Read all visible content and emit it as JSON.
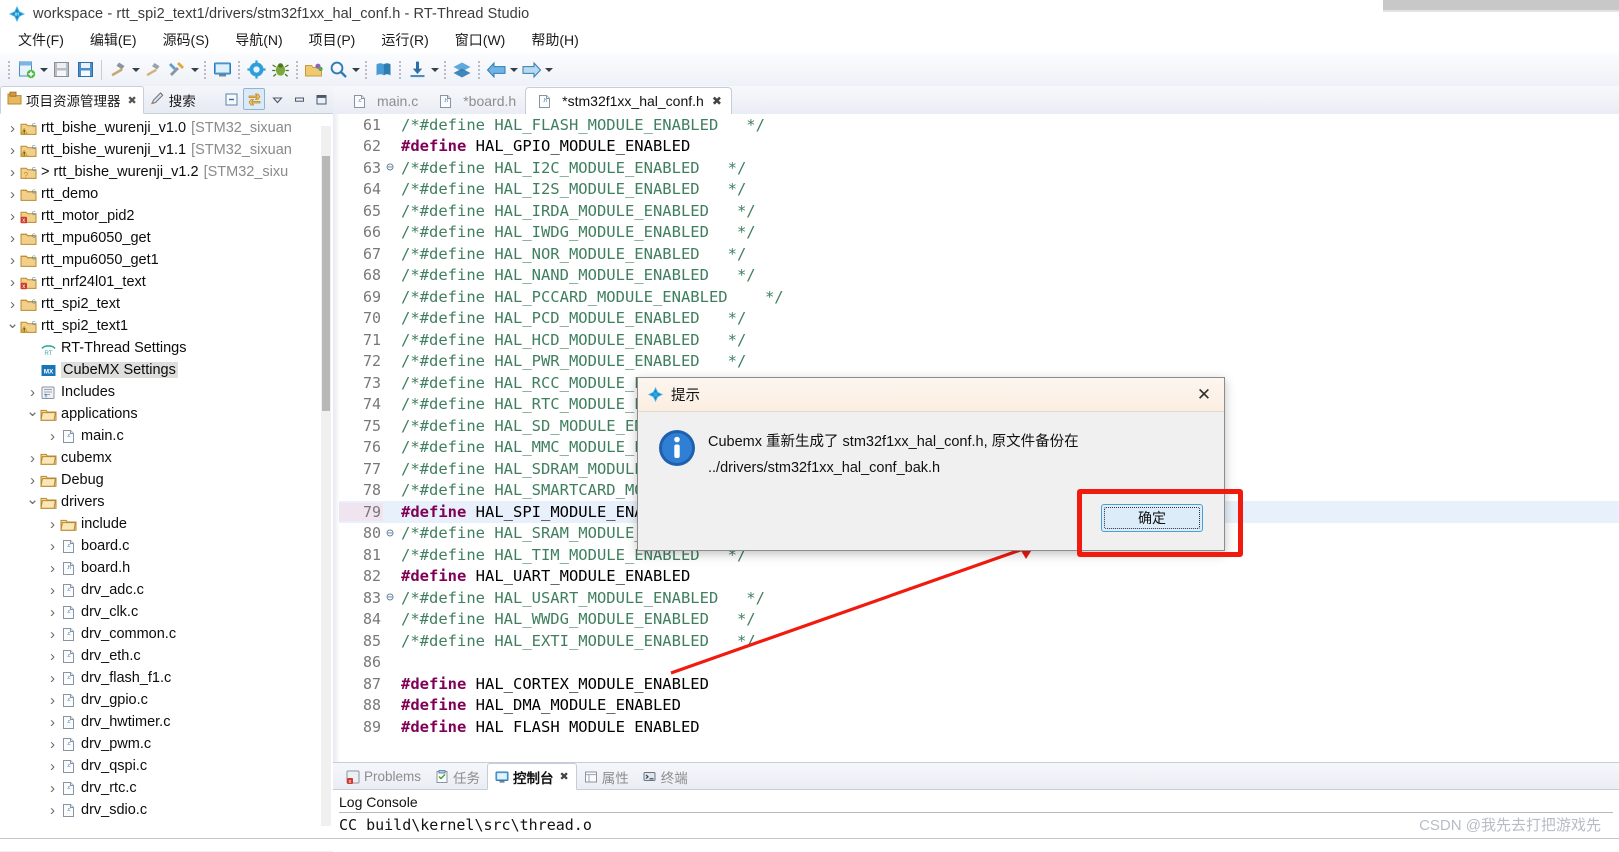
{
  "window": {
    "title": "workspace - rtt_spi2_text1/drivers/stm32f1xx_hal_conf.h - RT-Thread Studio",
    "app_icon": "rt-thread-logo-icon"
  },
  "menu": [
    {
      "label": "文件(F)",
      "mnemonic": "F"
    },
    {
      "label": "编辑(E)",
      "mnemonic": "E"
    },
    {
      "label": "源码(S)",
      "mnemonic": "S"
    },
    {
      "label": "导航(N)",
      "mnemonic": "N"
    },
    {
      "label": "项目(P)",
      "mnemonic": "P"
    },
    {
      "label": "运行(R)",
      "mnemonic": "R"
    },
    {
      "label": "窗口(W)",
      "mnemonic": "W"
    },
    {
      "label": "帮助(H)",
      "mnemonic": "H"
    }
  ],
  "toolbar": {
    "items": [
      "new-project-icon",
      "dropdown-arrow",
      "save-icon",
      "save-all-icon",
      "separator",
      "build-hammer-icon",
      "dropdown-arrow",
      "clean-icon",
      "build-config-icon",
      "dropdown-arrow",
      "separator",
      "open-terminal-icon",
      "separator",
      "settings-gear-icon",
      "debug-bug-icon",
      "separator",
      "open-resource-icon",
      "search-icon",
      "dropdown-arrow",
      "separator",
      "rtthread-pkg-icon",
      "separator",
      "download-flash-icon",
      "dropdown-arrow",
      "separator",
      "layers-icon",
      "separator",
      "back-arrow-icon",
      "dropdown-arrow",
      "forward-arrow-icon",
      "dropdown-arrow"
    ]
  },
  "explorer": {
    "tabs": [
      {
        "label": "项目资源管理器",
        "icon": "project-explorer-icon",
        "active": true,
        "closable": true
      },
      {
        "label": "搜索",
        "icon": "search-pencil-icon",
        "active": false,
        "closable": false
      }
    ],
    "tools": [
      "collapse-all-icon",
      "link-editor-icon",
      "view-menu-icon",
      "minimize-icon",
      "maximize-icon"
    ],
    "tree": [
      {
        "indent": 0,
        "arrow": "right",
        "icon": "c-project-warn-icon",
        "label": "rtt_bishe_wurenji_v1.0",
        "sub": "[STM32_sixuan",
        "selected": false
      },
      {
        "indent": 0,
        "arrow": "right",
        "icon": "c-project-warn-icon",
        "label": "rtt_bishe_wurenji_v1.1",
        "sub": "[STM32_sixuan",
        "selected": false
      },
      {
        "indent": 0,
        "arrow": "right",
        "icon": "c-project-q-icon",
        "label": "> rtt_bishe_wurenji_v1.2",
        "sub": "[STM32_sixu",
        "selected": false
      },
      {
        "indent": 0,
        "arrow": "right",
        "icon": "c-project-icon",
        "label": "rtt_demo",
        "sub": "",
        "selected": false
      },
      {
        "indent": 0,
        "arrow": "right",
        "icon": "c-project-err-icon",
        "label": "rtt_motor_pid2",
        "sub": "",
        "selected": false
      },
      {
        "indent": 0,
        "arrow": "right",
        "icon": "c-project-icon",
        "label": "rtt_mpu6050_get",
        "sub": "",
        "selected": false
      },
      {
        "indent": 0,
        "arrow": "right",
        "icon": "c-project-icon",
        "label": "rtt_mpu6050_get1",
        "sub": "",
        "selected": false
      },
      {
        "indent": 0,
        "arrow": "right",
        "icon": "c-project-err-icon",
        "label": "rtt_nrf24l01_text",
        "sub": "",
        "selected": false
      },
      {
        "indent": 0,
        "arrow": "right",
        "icon": "c-project-icon",
        "label": "rtt_spi2_text",
        "sub": "",
        "selected": false
      },
      {
        "indent": 0,
        "arrow": "down",
        "icon": "c-project-warn-icon",
        "label": "rtt_spi2_text1",
        "sub": "",
        "selected": false
      },
      {
        "indent": 1,
        "arrow": "none",
        "icon": "rt-settings-icon",
        "label": "RT-Thread Settings",
        "sub": "",
        "selected": false
      },
      {
        "indent": 1,
        "arrow": "none",
        "icon": "cubemx-settings-icon",
        "label": "CubeMX Settings",
        "sub": "",
        "selected": true
      },
      {
        "indent": 1,
        "arrow": "right",
        "icon": "includes-icon",
        "label": "Includes",
        "sub": "",
        "selected": false
      },
      {
        "indent": 1,
        "arrow": "down",
        "icon": "folder-icon",
        "label": "applications",
        "sub": "",
        "selected": false
      },
      {
        "indent": 2,
        "arrow": "right",
        "icon": "c-file-icon",
        "label": "main.c",
        "sub": "",
        "selected": false
      },
      {
        "indent": 1,
        "arrow": "right",
        "icon": "folder-icon",
        "label": "cubemx",
        "sub": "",
        "selected": false
      },
      {
        "indent": 1,
        "arrow": "right",
        "icon": "folder-icon",
        "label": "Debug",
        "sub": "",
        "selected": false
      },
      {
        "indent": 1,
        "arrow": "down",
        "icon": "folder-icon",
        "label": "drivers",
        "sub": "",
        "selected": false
      },
      {
        "indent": 2,
        "arrow": "right",
        "icon": "folder-icon",
        "label": "include",
        "sub": "",
        "selected": false
      },
      {
        "indent": 2,
        "arrow": "right",
        "icon": "c-file-icon",
        "label": "board.c",
        "sub": "",
        "selected": false
      },
      {
        "indent": 2,
        "arrow": "right",
        "icon": "h-file-icon",
        "label": "board.h",
        "sub": "",
        "selected": false
      },
      {
        "indent": 2,
        "arrow": "right",
        "icon": "c-file-icon",
        "label": "drv_adc.c",
        "sub": "",
        "selected": false
      },
      {
        "indent": 2,
        "arrow": "right",
        "icon": "c-file-icon",
        "label": "drv_clk.c",
        "sub": "",
        "selected": false
      },
      {
        "indent": 2,
        "arrow": "right",
        "icon": "c-file-icon",
        "label": "drv_common.c",
        "sub": "",
        "selected": false
      },
      {
        "indent": 2,
        "arrow": "right",
        "icon": "c-file-icon",
        "label": "drv_eth.c",
        "sub": "",
        "selected": false
      },
      {
        "indent": 2,
        "arrow": "right",
        "icon": "c-file-icon",
        "label": "drv_flash_f1.c",
        "sub": "",
        "selected": false
      },
      {
        "indent": 2,
        "arrow": "right",
        "icon": "c-file-icon",
        "label": "drv_gpio.c",
        "sub": "",
        "selected": false
      },
      {
        "indent": 2,
        "arrow": "right",
        "icon": "c-file-icon",
        "label": "drv_hwtimer.c",
        "sub": "",
        "selected": false
      },
      {
        "indent": 2,
        "arrow": "right",
        "icon": "c-file-icon",
        "label": "drv_pwm.c",
        "sub": "",
        "selected": false
      },
      {
        "indent": 2,
        "arrow": "right",
        "icon": "c-file-icon",
        "label": "drv_qspi.c",
        "sub": "",
        "selected": false
      },
      {
        "indent": 2,
        "arrow": "right",
        "icon": "c-file-icon",
        "label": "drv_rtc.c",
        "sub": "",
        "selected": false
      },
      {
        "indent": 2,
        "arrow": "right",
        "icon": "c-file-icon",
        "label": "drv_sdio.c",
        "sub": "",
        "selected": false
      }
    ]
  },
  "editor": {
    "tabs": [
      {
        "label": "main.c",
        "icon": "c-file-icon",
        "active": false,
        "closable": false
      },
      {
        "label": "*board.h",
        "icon": "h-file-icon",
        "active": false,
        "closable": false
      },
      {
        "label": "*stm32f1xx_hal_conf.h",
        "icon": "h-file-icon",
        "active": true,
        "closable": true
      }
    ],
    "lines": [
      {
        "num": 61,
        "fold": "",
        "kw": "",
        "rest": "/*#define HAL_FLASH_MODULE_ENABLED   */",
        "type": "comment",
        "hl": false
      },
      {
        "num": 62,
        "fold": "",
        "kw": "#define",
        "rest": " HAL_GPIO_MODULE_ENABLED",
        "type": "define",
        "hl": false
      },
      {
        "num": 63,
        "fold": "minus",
        "kw": "",
        "rest": "/*#define HAL_I2C_MODULE_ENABLED   */",
        "type": "comment",
        "hl": false
      },
      {
        "num": 64,
        "fold": "",
        "kw": "",
        "rest": "/*#define HAL_I2S_MODULE_ENABLED   */",
        "type": "comment",
        "hl": false
      },
      {
        "num": 65,
        "fold": "",
        "kw": "",
        "rest": "/*#define HAL_IRDA_MODULE_ENABLED   */",
        "type": "comment",
        "hl": false
      },
      {
        "num": 66,
        "fold": "",
        "kw": "",
        "rest": "/*#define HAL_IWDG_MODULE_ENABLED   */",
        "type": "comment",
        "hl": false
      },
      {
        "num": 67,
        "fold": "",
        "kw": "",
        "rest": "/*#define HAL_NOR_MODULE_ENABLED   */",
        "type": "comment",
        "hl": false
      },
      {
        "num": 68,
        "fold": "",
        "kw": "",
        "rest": "/*#define HAL_NAND_MODULE_ENABLED   */",
        "type": "comment",
        "hl": false
      },
      {
        "num": 69,
        "fold": "",
        "kw": "",
        "rest": "/*#define HAL_PCCARD_MODULE_ENABLED    */",
        "type": "comment",
        "hl": false
      },
      {
        "num": 70,
        "fold": "",
        "kw": "",
        "rest": "/*#define HAL_PCD_MODULE_ENABLED   */",
        "type": "comment",
        "hl": false
      },
      {
        "num": 71,
        "fold": "",
        "kw": "",
        "rest": "/*#define HAL_HCD_MODULE_ENABLED   */",
        "type": "comment",
        "hl": false
      },
      {
        "num": 72,
        "fold": "",
        "kw": "",
        "rest": "/*#define HAL_PWR_MODULE_ENABLED   */",
        "type": "comment",
        "hl": false
      },
      {
        "num": 73,
        "fold": "",
        "kw": "",
        "rest": "/*#define HAL_RCC_MODULE_ENABLED   */",
        "type": "comment",
        "hl": false
      },
      {
        "num": 74,
        "fold": "",
        "kw": "",
        "rest": "/*#define HAL_RTC_MODULE_ENABLED   */",
        "type": "comment",
        "hl": false
      },
      {
        "num": 75,
        "fold": "",
        "kw": "",
        "rest": "/*#define HAL_SD_MODULE_ENABLED   */",
        "type": "comment",
        "hl": false
      },
      {
        "num": 76,
        "fold": "",
        "kw": "",
        "rest": "/*#define HAL_MMC_MODULE_ENABLED   */",
        "type": "comment",
        "hl": false
      },
      {
        "num": 77,
        "fold": "",
        "kw": "",
        "rest": "/*#define HAL_SDRAM_MODULE_ENABLED   */",
        "type": "comment",
        "hl": false
      },
      {
        "num": 78,
        "fold": "",
        "kw": "",
        "rest": "/*#define HAL_SMARTCARD_MODULE_ENABLED   */",
        "type": "comment",
        "hl": false
      },
      {
        "num": 79,
        "fold": "",
        "kw": "#define",
        "rest": " HAL_SPI_MODULE_ENABLED",
        "type": "define",
        "hl": true
      },
      {
        "num": 80,
        "fold": "minus",
        "kw": "",
        "rest": "/*#define HAL_SRAM_MODULE_ENABLED   */",
        "type": "comment",
        "hl": false
      },
      {
        "num": 81,
        "fold": "",
        "kw": "",
        "rest": "/*#define HAL_TIM_MODULE_ENABLED   */",
        "type": "comment",
        "hl": false
      },
      {
        "num": 82,
        "fold": "",
        "kw": "#define",
        "rest": " HAL_UART_MODULE_ENABLED",
        "type": "define",
        "hl": false
      },
      {
        "num": 83,
        "fold": "minus",
        "kw": "",
        "rest": "/*#define HAL_USART_MODULE_ENABLED   */",
        "type": "comment",
        "hl": false
      },
      {
        "num": 84,
        "fold": "",
        "kw": "",
        "rest": "/*#define HAL_WWDG_MODULE_ENABLED   */",
        "type": "comment",
        "hl": false
      },
      {
        "num": 85,
        "fold": "",
        "kw": "",
        "rest": "/*#define HAL_EXTI_MODULE_ENABLED   */",
        "type": "comment",
        "hl": false
      },
      {
        "num": 86,
        "fold": "",
        "kw": "",
        "rest": "",
        "type": "blank",
        "hl": false
      },
      {
        "num": 87,
        "fold": "",
        "kw": "#define",
        "rest": " HAL_CORTEX_MODULE_ENABLED",
        "type": "define",
        "hl": false
      },
      {
        "num": 88,
        "fold": "",
        "kw": "#define",
        "rest": " HAL_DMA_MODULE_ENABLED",
        "type": "define",
        "hl": false
      },
      {
        "num": 89,
        "fold": "",
        "kw": "#define",
        "rest": " HAL FLASH MODULE ENABLED",
        "type": "define",
        "hl": false
      }
    ]
  },
  "bottom_panel": {
    "tabs": [
      {
        "label": "Problems",
        "icon": "problems-icon",
        "active": false,
        "closable": false
      },
      {
        "label": "任务",
        "icon": "tasks-icon",
        "active": false,
        "closable": false
      },
      {
        "label": "控制台",
        "icon": "console-icon",
        "active": true,
        "closable": true
      },
      {
        "label": "属性",
        "icon": "properties-icon",
        "active": false,
        "closable": false
      },
      {
        "label": "终端",
        "icon": "terminal-icon",
        "active": false,
        "closable": false
      }
    ],
    "console_title": "Log Console",
    "console_lines": [
      "CC build\\kernel\\src\\thread.o"
    ]
  },
  "dialog": {
    "title": "提示",
    "title_icon": "rt-thread-logo-icon",
    "info_icon": "info-circle-icon",
    "message_line1": "Cubemx 重新生成了 stm32f1xx_hal_conf.h, 原文件备份在",
    "message_line2": "../drivers/stm32f1xx_hal_conf_bak.h",
    "ok_label": "确定",
    "close_label": "✕"
  },
  "annotations": {
    "highlight_color": "#f11a0e",
    "arrow_label": "red-arrow-pointing-to-ok-button"
  },
  "watermark": "CSDN @我先去打把游戏先"
}
